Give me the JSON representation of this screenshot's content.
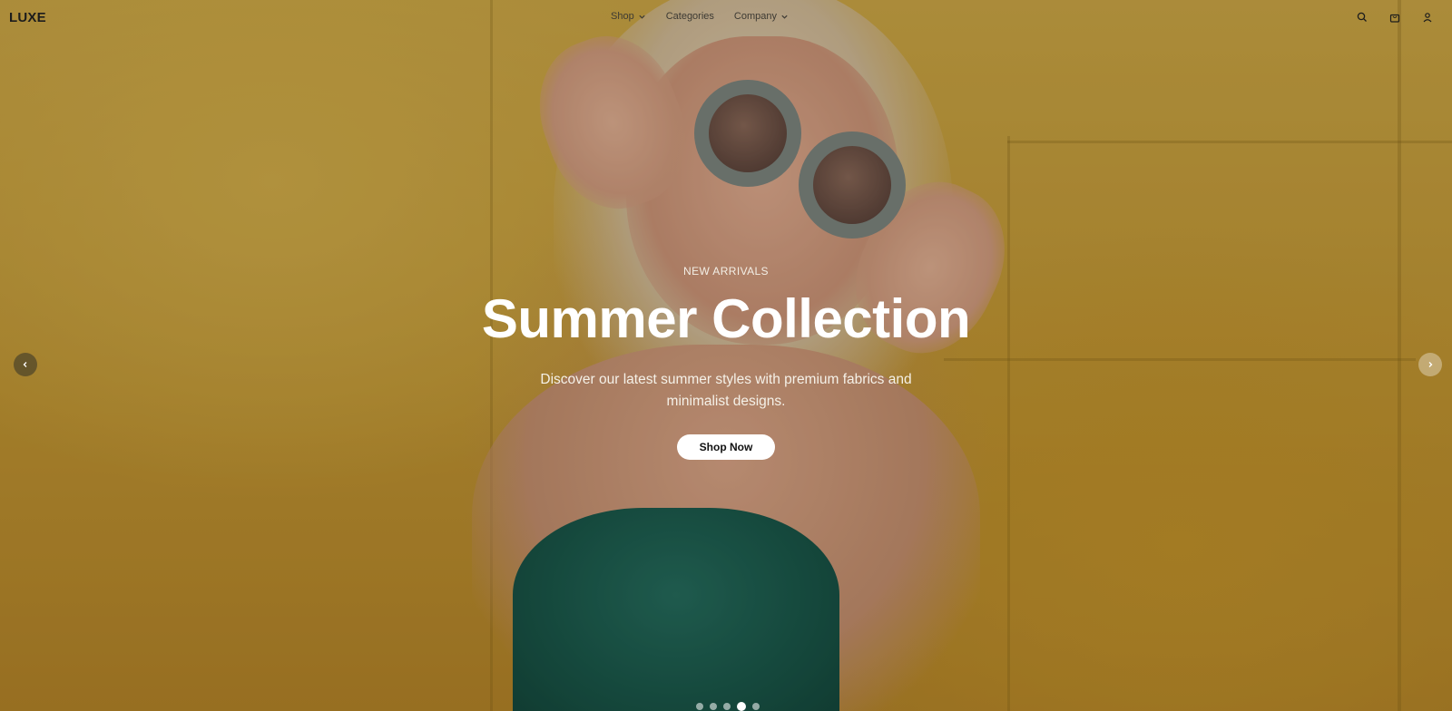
{
  "brand": {
    "logo": "LUXE"
  },
  "nav": {
    "items": [
      {
        "label": "Shop",
        "has_dropdown": true
      },
      {
        "label": "Categories",
        "has_dropdown": false
      },
      {
        "label": "Company",
        "has_dropdown": true
      }
    ],
    "icons": [
      "search-icon",
      "shopping-bag-icon",
      "user-icon"
    ]
  },
  "hero": {
    "eyebrow": "NEW ARRIVALS",
    "title": "Summer Collection",
    "description": "Discover our latest summer styles with premium fabrics and minimalist designs.",
    "cta_label": "Shop Now",
    "prev_label": "‹",
    "next_label": "›"
  },
  "carousel": {
    "slide_count": 5,
    "active_index": 3
  },
  "colors": {
    "accent": "#ffffff",
    "text_dark": "#1c1c1c",
    "background": "#c9a23c"
  }
}
